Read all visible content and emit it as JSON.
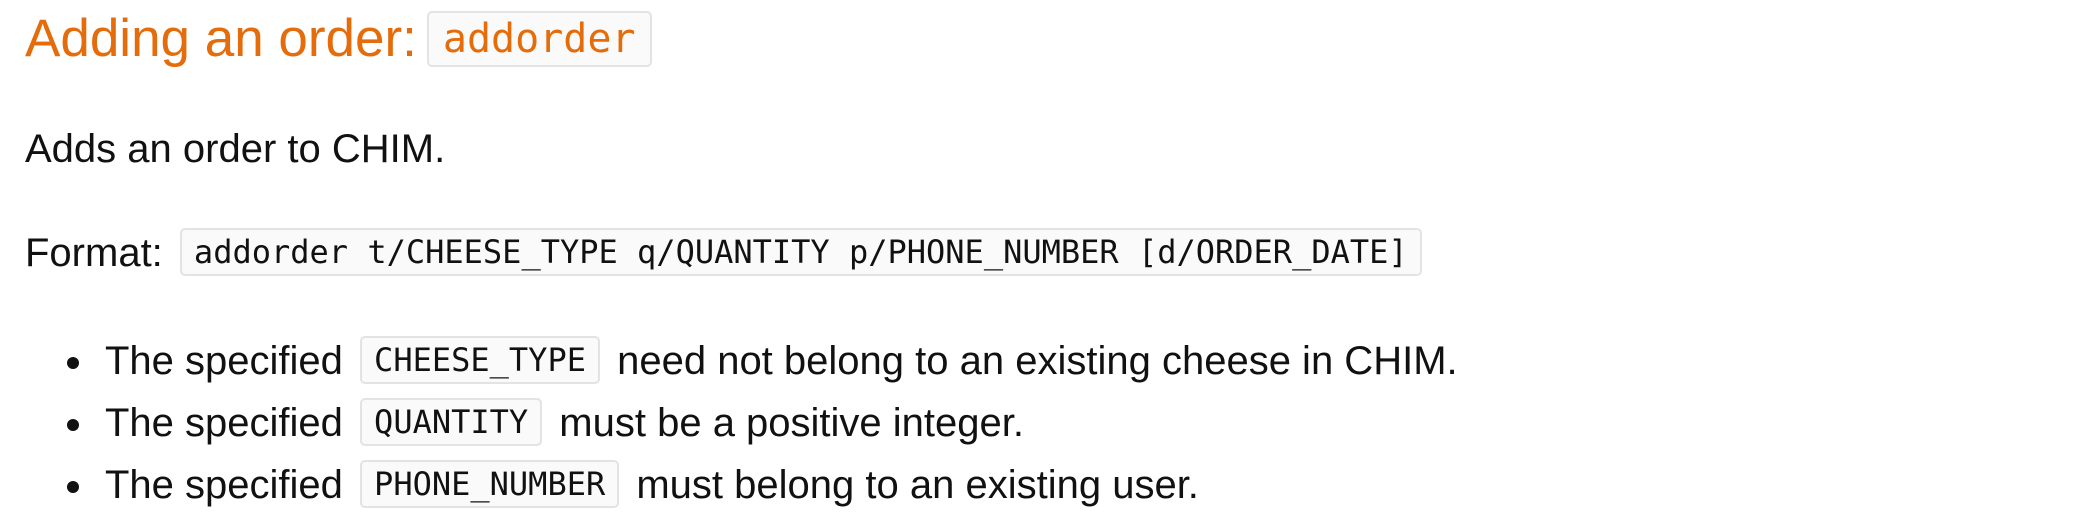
{
  "heading": {
    "text": "Adding an order:",
    "command": "addorder"
  },
  "description": "Adds an order to CHIM.",
  "format": {
    "label": "Format:",
    "syntax": "addorder t/CHEESE_TYPE q/QUANTITY p/PHONE_NUMBER [d/ORDER_DATE]"
  },
  "notes": [
    {
      "prefix": "The specified",
      "param": "CHEESE_TYPE",
      "suffix": "need not belong to an existing cheese in CHIM."
    },
    {
      "prefix": "The specified",
      "param": "QUANTITY",
      "suffix": "must be a positive integer."
    },
    {
      "prefix": "The specified",
      "param": "PHONE_NUMBER",
      "suffix": "must belong to an existing user."
    }
  ]
}
